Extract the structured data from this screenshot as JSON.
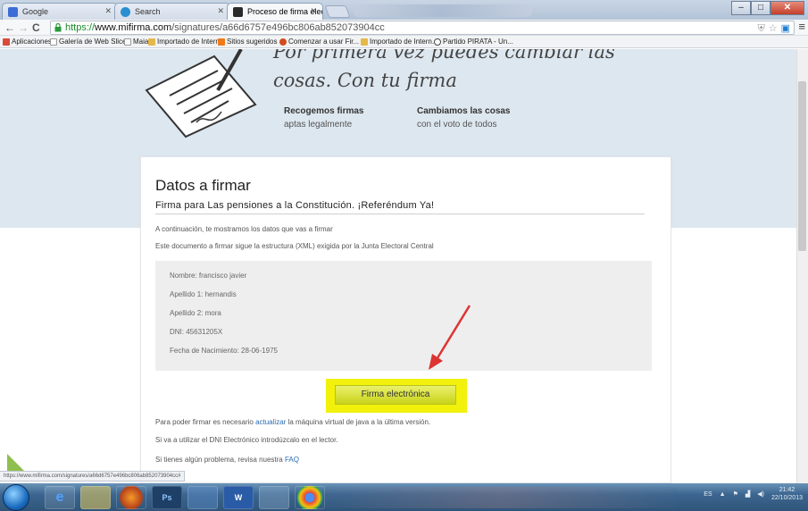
{
  "browser": {
    "tabs": [
      {
        "label": "Google",
        "color": "#3b6dd6"
      },
      {
        "label": "Search",
        "color": "#2a8fd0"
      },
      {
        "label": "Proceso de firma electrón",
        "color": "#2a2a2a"
      }
    ],
    "url_scheme": "https://",
    "url_host": "www.mifirma.com",
    "url_path": "/signatures/a66d6757e496bc806ab852073904cc",
    "bookmarks": [
      {
        "label": "Aplicaciones",
        "color": "#d94a38"
      },
      {
        "label": "Galería de Web Slice",
        "color": "#e8e8e8"
      },
      {
        "label": "Maia",
        "color": "#e8e8e8"
      },
      {
        "label": "Importado de Intern...",
        "color": "#e6b84a"
      },
      {
        "label": "Sitios sugeridos",
        "color": "#f07a1a"
      },
      {
        "label": "Comenzar a usar Fir...",
        "color": "#d34b1f"
      },
      {
        "label": "Importado de Intern...",
        "color": "#e6b84a"
      },
      {
        "label": "Partido PIRATA - Un...",
        "color": "#444444"
      }
    ]
  },
  "hero": {
    "tagline_line1": "Por primera vez puedes cambiar las",
    "tagline_line2": "cosas. Con tu firma",
    "feature1_title": "Recogemos firmas",
    "feature1_sub": "aptas legalmente",
    "feature2_title": "Cambiamos las cosas",
    "feature2_sub": "con el voto de todos"
  },
  "card": {
    "heading": "Datos a firmar",
    "subtitle": "Firma para Las pensiones a la Constitución. ¡Referéndum Ya!",
    "intro1": "A continuación, te mostramos los datos que vas a firmar",
    "intro2": "Este documento a firmar sigue la estructura (XML) exigida por la Junta Electoral Central",
    "fields": [
      "Nombre: francisco javier",
      "Apellido 1: hernandis",
      "Apellido 2: mora",
      "DNI: 45631205X",
      "Fecha de Nacimiento: 28-06-1975"
    ],
    "button_label": "Firma electrónica",
    "note1_pre": "Para poder firmar es necesario ",
    "note1_link": "actualizar",
    "note1_post": " la máquina virtual de java a la última versión.",
    "note2": "Si va a utilizar el DNI Electrónico introdúzcalo en el lector.",
    "note3_pre": "Si tienes algún problema, revisa nuestra ",
    "note3_link": "FAQ"
  },
  "status_url": "https://www.mifirma.com/signatures/a66d6757e496bc806ab852073904cc#",
  "taskbar": {
    "apps": [
      "ie",
      "explorer",
      "firefox",
      "Ps",
      "vpn",
      "W",
      "img",
      "chrome"
    ],
    "lang": "ES",
    "time": "21:42",
    "date": "22/10/2013"
  }
}
